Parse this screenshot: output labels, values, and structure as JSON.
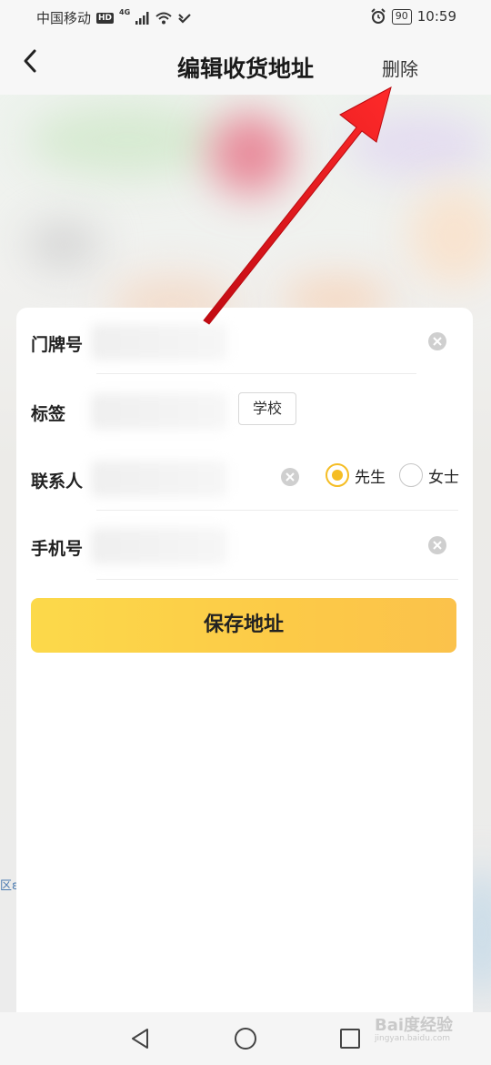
{
  "status_bar": {
    "carrier": "中国移动",
    "hd": "HD",
    "network": "4G",
    "battery": "90",
    "time": "10:59"
  },
  "nav": {
    "title": "编辑收货地址",
    "delete_label": "删除",
    "back_icon": "chevron-left-icon"
  },
  "form": {
    "door_number_label": "门牌号",
    "tag_label": "标签",
    "tag_visible_option": "学校",
    "contact_label": "联系人",
    "gender_options": [
      {
        "label": "先生",
        "checked": true
      },
      {
        "label": "女士",
        "checked": false
      }
    ],
    "phone_label": "手机号",
    "save_label": "保存地址"
  },
  "map": {
    "edge_label": "区ε"
  },
  "watermark": {
    "brand": "Bai度经验",
    "url": "jingyan.baidu.com"
  },
  "colors": {
    "accent": "#f5bd24",
    "save_gradient_start": "#fcd94a",
    "save_gradient_end": "#fbc24b",
    "annotation_arrow": "#e8111b"
  }
}
